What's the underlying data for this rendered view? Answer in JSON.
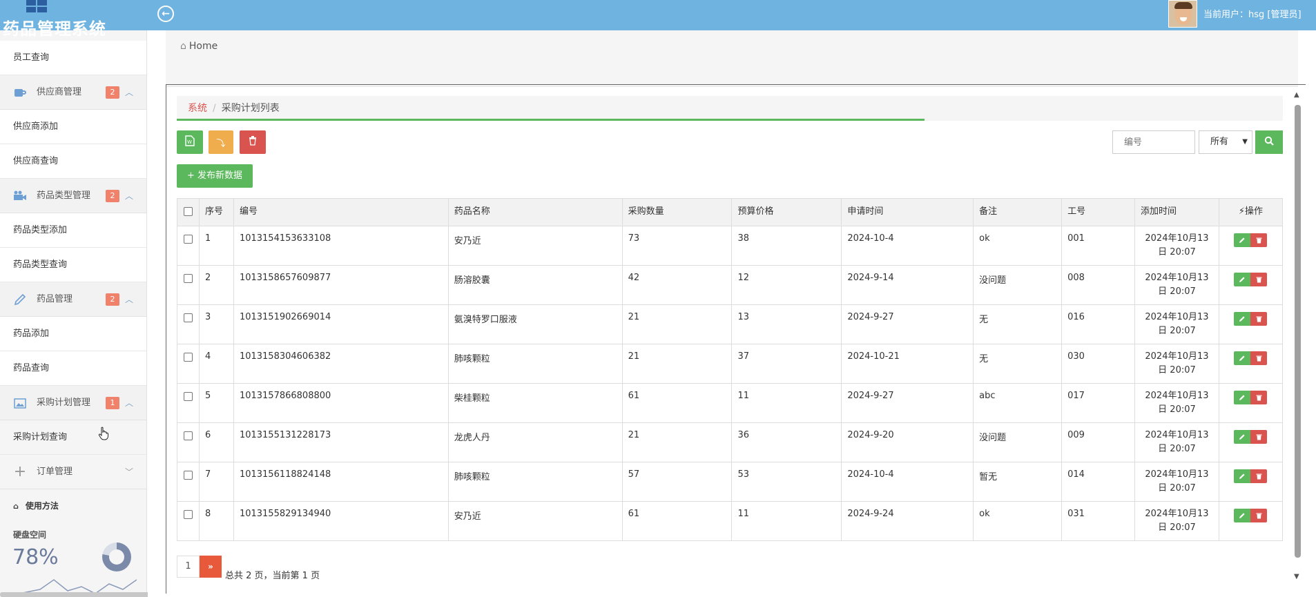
{
  "header": {
    "app_title": "药品管理系统",
    "current_user": "当前用户：hsg [管理员]"
  },
  "sidebar": {
    "items": [
      {
        "type": "sub",
        "label": "员工查询"
      },
      {
        "type": "group",
        "label": "供应商管理",
        "badge": "2",
        "icon": "coffee-cup-icon"
      },
      {
        "type": "sub",
        "label": "供应商添加"
      },
      {
        "type": "sub",
        "label": "供应商查询"
      },
      {
        "type": "group",
        "label": "药品类型管理",
        "badge": "2",
        "icon": "video-camera-icon"
      },
      {
        "type": "sub",
        "label": "药品类型添加"
      },
      {
        "type": "sub",
        "label": "药品类型查询"
      },
      {
        "type": "group",
        "label": "药品管理",
        "badge": "2",
        "icon": "pencil-icon"
      },
      {
        "type": "sub",
        "label": "药品添加"
      },
      {
        "type": "sub",
        "label": "药品查询"
      },
      {
        "type": "group",
        "label": "采购计划管理",
        "badge": "1",
        "icon": "picture-icon"
      },
      {
        "type": "sub",
        "label": "采购计划查询"
      },
      {
        "type": "group",
        "label": "订单管理",
        "badge": "",
        "icon": "plus-icon"
      }
    ],
    "usage_title": "使用方法",
    "disk_label": "硬盘空间",
    "disk_percent": "78%",
    "disk_fraction": 0.78
  },
  "breadcrumb": {
    "home": "Home",
    "system": "系统",
    "separator": "/",
    "current": "采购计划列表"
  },
  "toolbar": {
    "publish_label": "+ 发布新数据",
    "search_placeholder": "编号",
    "filter_selected": "所有"
  },
  "table": {
    "headers": [
      "序号",
      "编号",
      "药品名称",
      "采购数量",
      "预算价格",
      "申请时间",
      "备注",
      "工号",
      "添加时间",
      "操作"
    ],
    "rows": [
      [
        "1",
        "1013154153633108",
        "安乃近",
        "73",
        "38",
        "2024-10-4",
        "ok",
        "001",
        "2024年10月13日 20:07"
      ],
      [
        "2",
        "1013158657609877",
        "肠溶胶囊",
        "42",
        "12",
        "2024-9-14",
        "没问题",
        "008",
        "2024年10月13日 20:07"
      ],
      [
        "3",
        "1013151902669014",
        "氨溴特罗口服液",
        "21",
        "13",
        "2024-9-27",
        "无",
        "016",
        "2024年10月13日 20:07"
      ],
      [
        "4",
        "1013158304606382",
        "肺咳颗粒",
        "21",
        "37",
        "2024-10-21",
        "无",
        "030",
        "2024年10月13日 20:07"
      ],
      [
        "5",
        "1013157866808800",
        "柴桂颗粒",
        "61",
        "11",
        "2024-9-27",
        "abc",
        "017",
        "2024年10月13日 20:07"
      ],
      [
        "6",
        "1013155131228173",
        "龙虎人丹",
        "21",
        "36",
        "2024-9-20",
        "没问题",
        "009",
        "2024年10月13日 20:07"
      ],
      [
        "7",
        "1013156118824148",
        "肺咳颗粒",
        "57",
        "53",
        "2024-10-4",
        "暂无",
        "014",
        "2024年10月13日 20:07"
      ],
      [
        "8",
        "1013155829134940",
        "安乃近",
        "61",
        "11",
        "2024-9-24",
        "ok",
        "031",
        "2024年10月13日 20:07"
      ]
    ]
  },
  "pagination": {
    "current_page": "1",
    "next_label": "»",
    "info": "总共 2 页，当前第 1 页"
  },
  "colors": {
    "topbar": "#6fb3e0",
    "green": "#5cb85c",
    "orange": "#f0ad4e",
    "red": "#d9534f",
    "badge": "#f0826c"
  }
}
